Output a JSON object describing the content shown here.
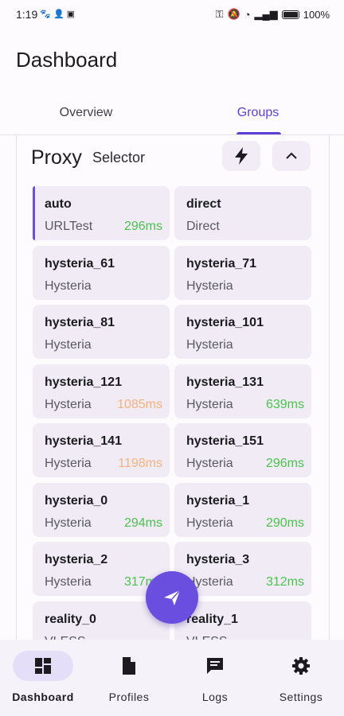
{
  "status_bar": {
    "time": "1:19",
    "battery": "100%"
  },
  "page_title": "Dashboard",
  "tabs": [
    {
      "label": "Overview"
    },
    {
      "label": "Groups"
    }
  ],
  "group": {
    "name": "Proxy",
    "type": "Selector"
  },
  "colors": {
    "accent": "#6a4ee0",
    "good": "#4cc24e",
    "warn": "#f6b27b"
  },
  "proxies": [
    {
      "name": "auto",
      "type": "URLTest",
      "delay": "296ms",
      "delay_status": "good",
      "selected": true
    },
    {
      "name": "direct",
      "type": "Direct",
      "delay": "",
      "delay_status": ""
    },
    {
      "name": "hysteria_61",
      "type": "Hysteria",
      "delay": "",
      "delay_status": ""
    },
    {
      "name": "hysteria_71",
      "type": "Hysteria",
      "delay": "",
      "delay_status": ""
    },
    {
      "name": "hysteria_81",
      "type": "Hysteria",
      "delay": "",
      "delay_status": ""
    },
    {
      "name": "hysteria_101",
      "type": "Hysteria",
      "delay": "",
      "delay_status": ""
    },
    {
      "name": "hysteria_121",
      "type": "Hysteria",
      "delay": "1085ms",
      "delay_status": "warn"
    },
    {
      "name": "hysteria_131",
      "type": "Hysteria",
      "delay": "639ms",
      "delay_status": "good"
    },
    {
      "name": "hysteria_141",
      "type": "Hysteria",
      "delay": "1198ms",
      "delay_status": "warn"
    },
    {
      "name": "hysteria_151",
      "type": "Hysteria",
      "delay": "296ms",
      "delay_status": "good"
    },
    {
      "name": "hysteria_0",
      "type": "Hysteria",
      "delay": "294ms",
      "delay_status": "good"
    },
    {
      "name": "hysteria_1",
      "type": "Hysteria",
      "delay": "290ms",
      "delay_status": "good"
    },
    {
      "name": "hysteria_2",
      "type": "Hysteria",
      "delay": "317ms",
      "delay_status": "good"
    },
    {
      "name": "hysteria_3",
      "type": "Hysteria",
      "delay": "312ms",
      "delay_status": "good"
    },
    {
      "name": "reality_0",
      "type": "VLESS",
      "delay": "",
      "delay_status": ""
    },
    {
      "name": "reality_1",
      "type": "VLESS",
      "delay": "",
      "delay_status": ""
    }
  ],
  "bottom_nav": [
    {
      "label": "Dashboard",
      "icon": "dashboard-icon",
      "active": true
    },
    {
      "label": "Profiles",
      "icon": "file-icon"
    },
    {
      "label": "Logs",
      "icon": "chat-icon"
    },
    {
      "label": "Settings",
      "icon": "gear-icon"
    }
  ]
}
